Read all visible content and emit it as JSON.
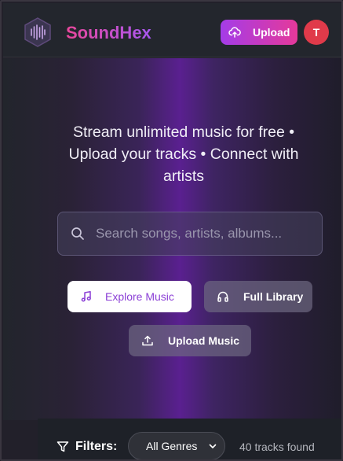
{
  "header": {
    "brand": "SoundHex",
    "upload_label": "Upload",
    "avatar_initial": "T"
  },
  "hero": {
    "tagline": "Stream unlimited music for free • Upload your tracks • Connect with artists"
  },
  "search": {
    "placeholder": "Search songs, artists, albums..."
  },
  "actions": {
    "explore_label": "Explore Music",
    "library_label": "Full Library",
    "upload_music_label": "Upload Music"
  },
  "filters": {
    "label": "Filters:",
    "genre_selected": "All Genres",
    "track_count": "40 tracks found"
  },
  "colors": {
    "brand_pink": "#e9479b",
    "brand_purple": "#a657f0",
    "avatar_red": "#e03a4a"
  }
}
